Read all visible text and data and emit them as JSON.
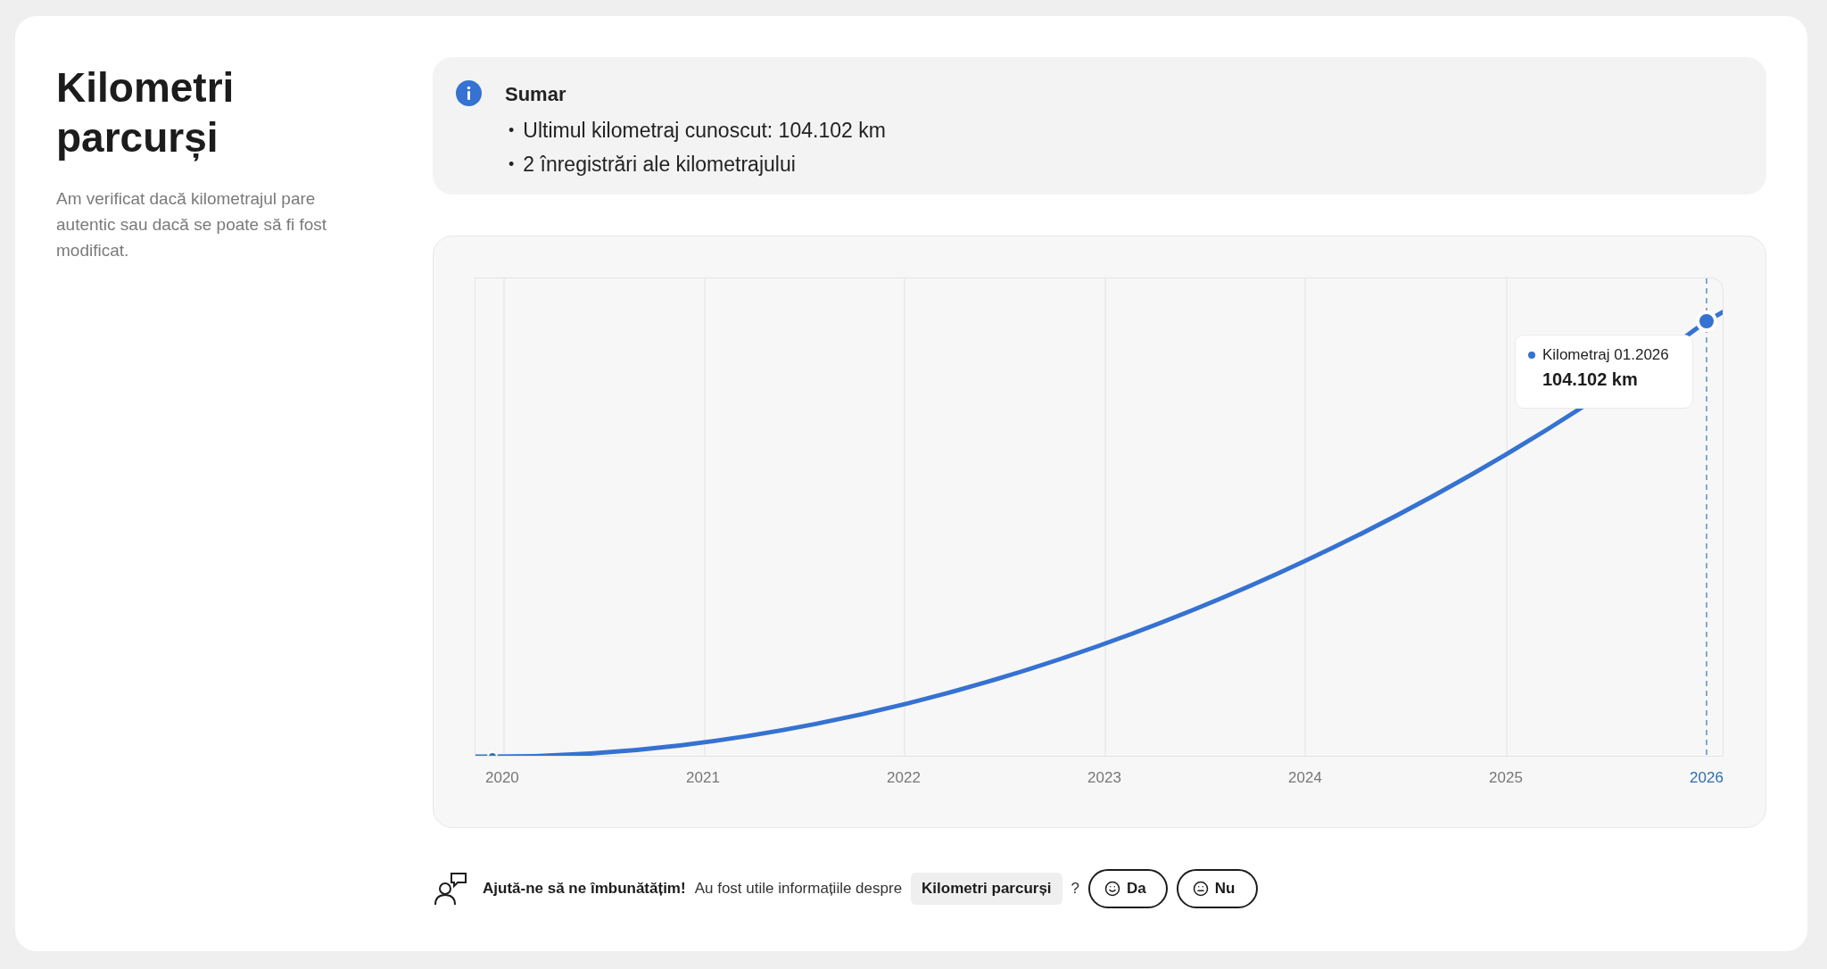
{
  "title": "Kilometri parcurși",
  "description": "Am verificat dacă kilometrajul pare autentic sau dacă se poate să fi fost modificat.",
  "summary": {
    "heading": "Sumar",
    "bullet": "•",
    "items": [
      "Ultimul kilometraj cunoscut: 104.102 km",
      "2 înregistrări ale kilometrajului"
    ]
  },
  "chart": {
    "x_labels": [
      {
        "label": "2020",
        "selected": false
      },
      {
        "label": "2021",
        "selected": false
      },
      {
        "label": "2022",
        "selected": false
      },
      {
        "label": "2023",
        "selected": false
      },
      {
        "label": "2024",
        "selected": false
      },
      {
        "label": "2025",
        "selected": false
      },
      {
        "label": "2026",
        "selected": true
      }
    ],
    "tooltip": {
      "label": "Kilometraj 01.2026",
      "value": "104.102 km"
    }
  },
  "feedback": {
    "prompt": "Ajută-ne să ne îmbunătățim!",
    "question": "Au fost utile informațiile despre",
    "topic": "Kilometri parcurși",
    "question_end": "?",
    "buttons": [
      {
        "label": "Da",
        "kind": "yes"
      },
      {
        "label": "Nu",
        "kind": "no"
      }
    ]
  }
}
